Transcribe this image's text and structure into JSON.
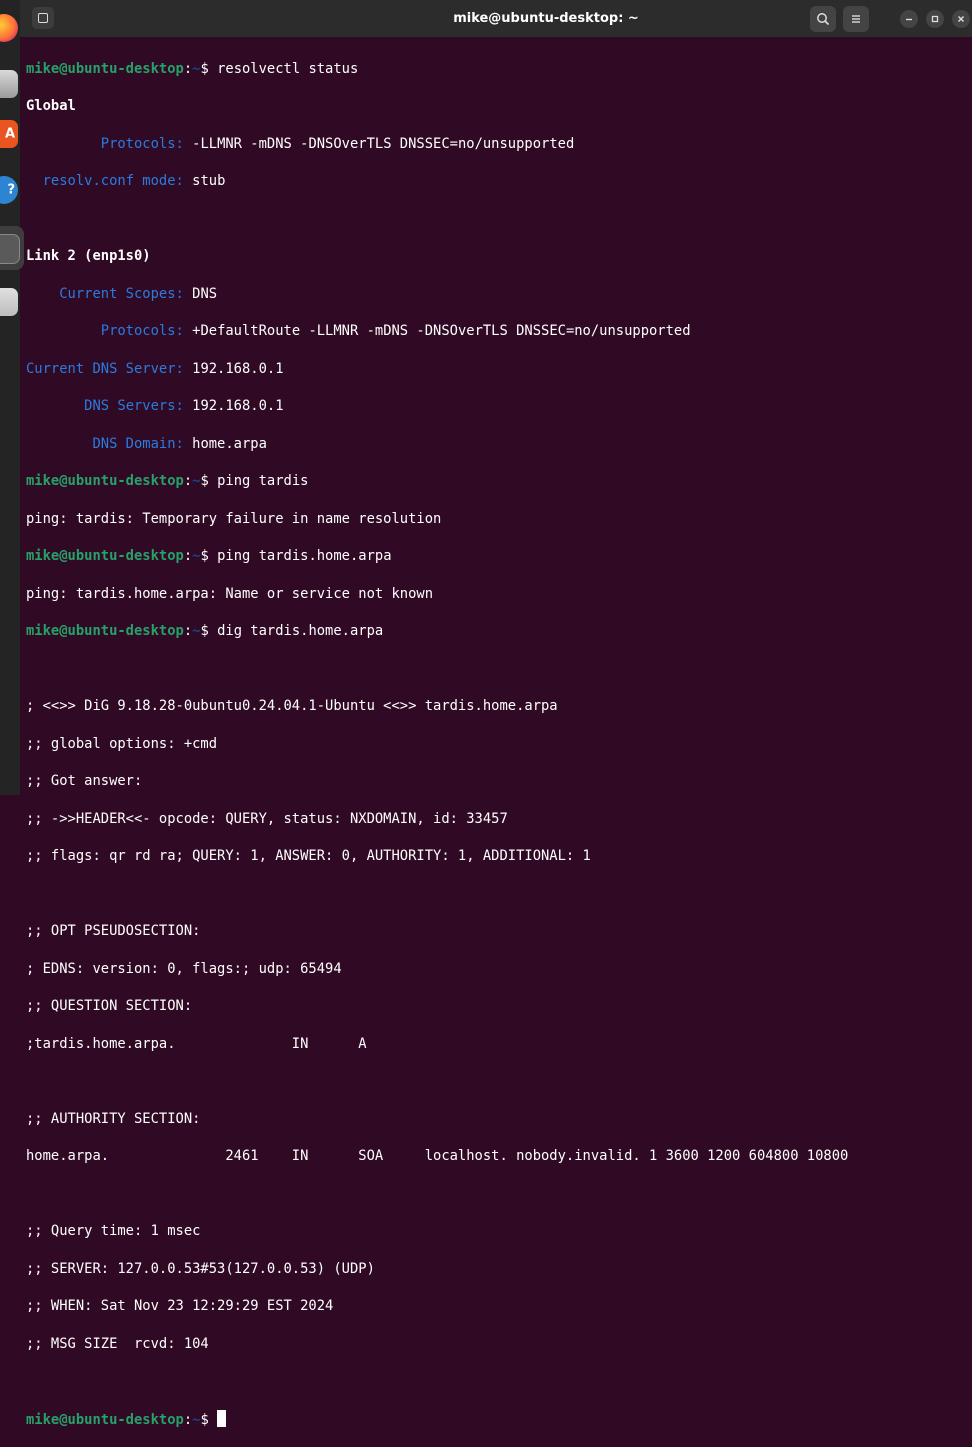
{
  "window": {
    "title": "mike@ubuntu-desktop: ~"
  },
  "dock": {
    "items": [
      "firefox",
      "files",
      "app-center",
      "help",
      "terminal",
      "trash"
    ]
  },
  "prompt": {
    "userhost": "mike@ubuntu-desktop",
    "sep": ":",
    "path": "~",
    "symbol": "$ "
  },
  "terminal": {
    "cmd1": "resolvectl status",
    "global_header": "Global",
    "g_protocols_key": "Protocols:",
    "g_protocols_val": " -LLMNR -mDNS -DNSOverTLS DNSSEC=no/unsupported",
    "g_resolv_key": "resolv.conf mode:",
    "g_resolv_val": " stub",
    "link_header": "Link 2 (enp1s0)",
    "l_scopes_key": "Current Scopes:",
    "l_scopes_val": " DNS",
    "l_protocols_key": "Protocols:",
    "l_protocols_val": " +DefaultRoute -LLMNR -mDNS -DNSOverTLS DNSSEC=no/unsupported",
    "l_cur_dns_key": "Current DNS Server:",
    "l_cur_dns_val": " 192.168.0.1",
    "l_dns_servers_key": "DNS Servers:",
    "l_dns_servers_val": " 192.168.0.1",
    "l_dns_domain_key": "DNS Domain:",
    "l_dns_domain_val": " home.arpa",
    "cmd2": "ping tardis",
    "out2": "ping: tardis: Temporary failure in name resolution",
    "cmd3": "ping tardis.home.arpa",
    "out3": "ping: tardis.home.arpa: Name or service not known",
    "cmd4": "dig tardis.home.arpa",
    "dig_lines_1": [
      "; <<>> DiG 9.18.28-0ubuntu0.24.04.1-Ubuntu <<>> tardis.home.arpa",
      ";; global options: +cmd",
      ";; Got answer:",
      ";; ->>HEADER<<- opcode: QUERY, status: NXDOMAIN, id: 33457",
      ";; flags: qr rd ra; QUERY: 1, ANSWER: 0, AUTHORITY: 1, ADDITIONAL: 1"
    ],
    "dig_lines_2": [
      ";; OPT PSEUDOSECTION:",
      "; EDNS: version: 0, flags:; udp: 65494",
      ";; QUESTION SECTION:",
      ";tardis.home.arpa.              IN      A"
    ],
    "dig_lines_3": [
      ";; AUTHORITY SECTION:",
      "home.arpa.              2461    IN      SOA     localhost. nobody.invalid. 1 3600 1200 604800 10800"
    ],
    "dig_lines_4": [
      ";; Query time: 1 msec",
      ";; SERVER: 127.0.0.53#53(127.0.0.53) (UDP)",
      ";; WHEN: Sat Nov 23 12:29:29 EST 2024",
      ";; MSG SIZE  rcvd: 104"
    ]
  },
  "colors": {
    "background": "#300a24",
    "prompt_user": "#26a269",
    "prompt_path": "#12488b",
    "key_text": "#2a7bde",
    "titlebar": "#2c2c2c"
  }
}
